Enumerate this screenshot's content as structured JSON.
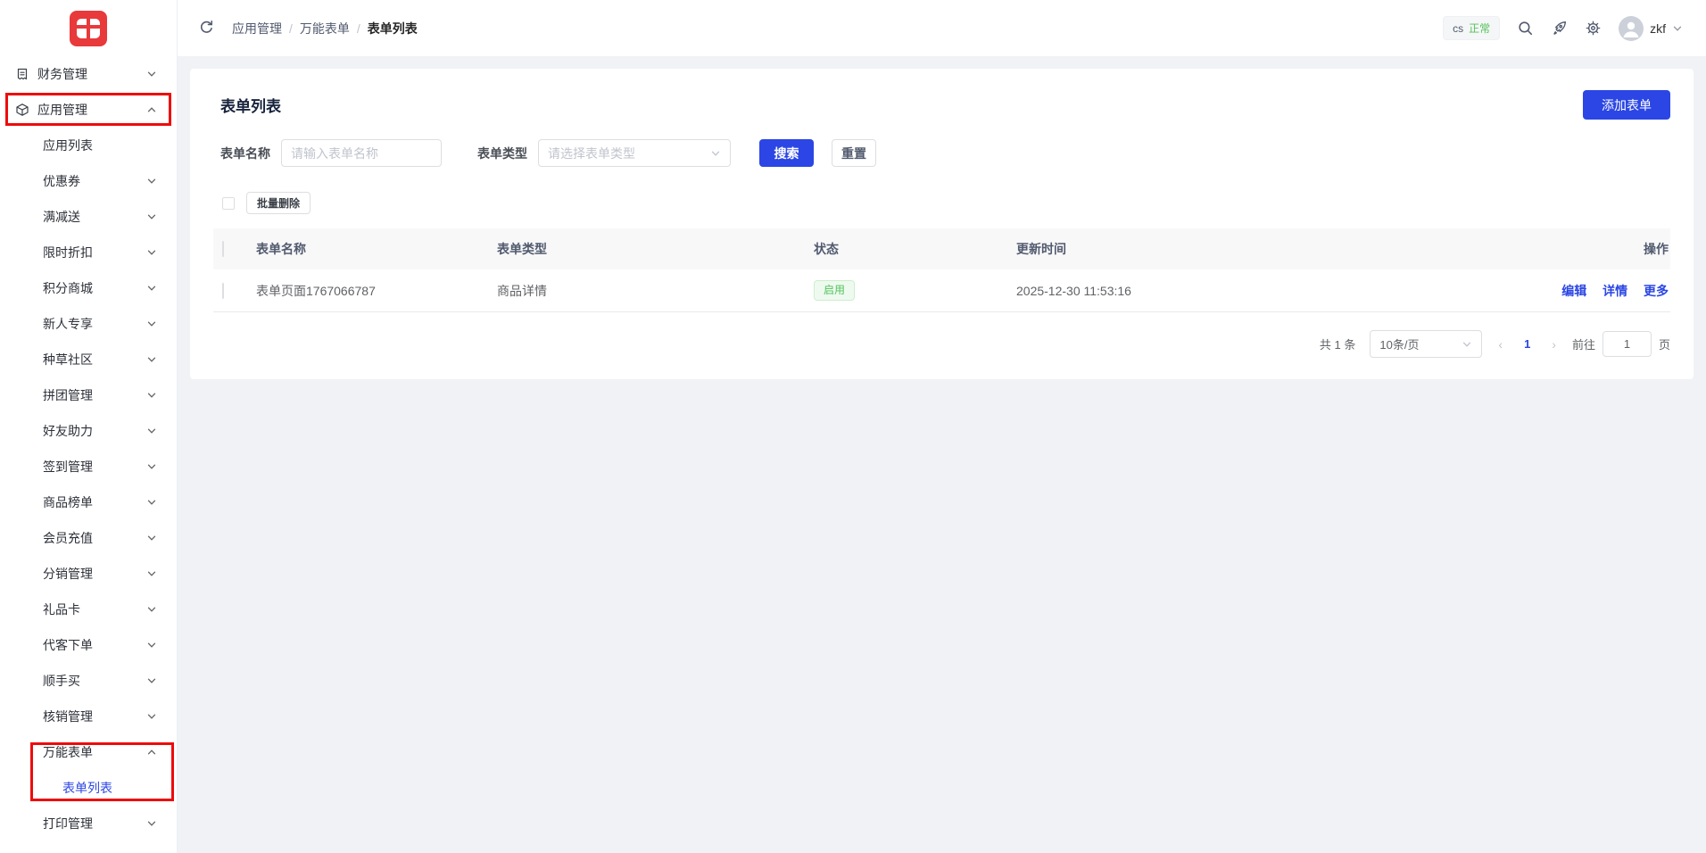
{
  "colors": {
    "primary": "#2b46e4",
    "annotation_red": "#ee0b0b",
    "success_green": "#53c25c",
    "logo_red": "#e8393b"
  },
  "sidebar": {
    "menu": [
      {
        "label": "财务管理"
      },
      {
        "label": "应用管理"
      },
      {
        "label": "应用列表"
      },
      {
        "label": "优惠券"
      },
      {
        "label": "满减送"
      },
      {
        "label": "限时折扣"
      },
      {
        "label": "积分商城"
      },
      {
        "label": "新人专享"
      },
      {
        "label": "种草社区"
      },
      {
        "label": "拼团管理"
      },
      {
        "label": "好友助力"
      },
      {
        "label": "签到管理"
      },
      {
        "label": "商品榜单"
      },
      {
        "label": "会员充值"
      },
      {
        "label": "分销管理"
      },
      {
        "label": "礼品卡"
      },
      {
        "label": "代客下单"
      },
      {
        "label": "顺手买"
      },
      {
        "label": "核销管理"
      },
      {
        "label": "万能表单"
      },
      {
        "label": "表单列表"
      },
      {
        "label": "打印管理"
      }
    ]
  },
  "topbar": {
    "breadcrumb": {
      "items": [
        "应用管理",
        "万能表单",
        "表单列表"
      ],
      "separator": "/"
    },
    "env_badge": {
      "prefix": "cs",
      "status": "正常"
    },
    "username": "zkf"
  },
  "page": {
    "title": "表单列表",
    "add_button": "添加表单",
    "filters": {
      "name_label": "表单名称",
      "name_placeholder": "请输入表单名称",
      "type_label": "表单类型",
      "type_placeholder": "请选择表单类型",
      "search_button": "搜索",
      "reset_button": "重置"
    },
    "batch_delete_button": "批量删除",
    "table": {
      "headers": [
        "表单名称",
        "表单类型",
        "状态",
        "更新时间",
        "操作"
      ],
      "rows": [
        {
          "name": "表单页面1767066787",
          "type": "商品详情",
          "status": "启用",
          "updated": "2025-12-30 11:53:16",
          "actions": [
            "编辑",
            "详情",
            "更多"
          ]
        }
      ]
    },
    "pagination": {
      "total": "共 1 条",
      "page_size": "10条/页",
      "prev": "‹",
      "current_page": "1",
      "next": "›",
      "goto_label": "前往",
      "goto_value": "1",
      "page_unit": "页"
    }
  }
}
